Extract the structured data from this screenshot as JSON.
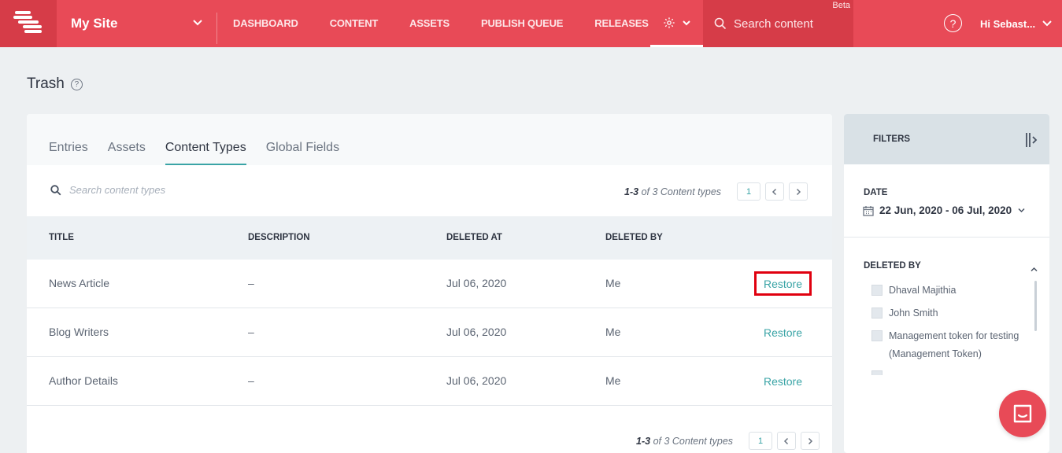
{
  "header": {
    "site_name": "My Site",
    "nav": [
      "DASHBOARD",
      "CONTENT",
      "ASSETS",
      "PUBLISH QUEUE",
      "RELEASES"
    ],
    "search_placeholder": "Search content",
    "beta_label": "Beta",
    "help_glyph": "?",
    "user_greeting": "Hi Sebast..."
  },
  "page": {
    "title": "Trash"
  },
  "tabs": [
    "Entries",
    "Assets",
    "Content Types",
    "Global Fields"
  ],
  "active_tab": "Content Types",
  "toolbar": {
    "search_placeholder": "Search content types",
    "range": "1-3",
    "range_suffix": "of 3 Content types",
    "page": "1"
  },
  "table": {
    "headers": [
      "TITLE",
      "DESCRIPTION",
      "DELETED AT",
      "DELETED BY"
    ],
    "rows": [
      {
        "title": "News Article",
        "description": "–",
        "deleted_at": "Jul 06, 2020",
        "deleted_by": "Me",
        "action": "Restore"
      },
      {
        "title": "Blog Writers",
        "description": "–",
        "deleted_at": "Jul 06, 2020",
        "deleted_by": "Me",
        "action": "Restore"
      },
      {
        "title": "Author Details",
        "description": "–",
        "deleted_at": "Jul 06, 2020",
        "deleted_by": "Me",
        "action": "Restore"
      }
    ]
  },
  "filters": {
    "title": "FILTERS",
    "date_label": "DATE",
    "date_value": "22 Jun, 2020 - 06 Jul, 2020",
    "deleted_by_label": "DELETED BY",
    "users": [
      "Dhaval Majithia",
      "John Smith",
      "Management token for testing",
      "(Management Token)"
    ]
  },
  "colors": {
    "brand": "#e84a57",
    "accent": "#3aa4a6",
    "highlight": "#e0000f"
  }
}
